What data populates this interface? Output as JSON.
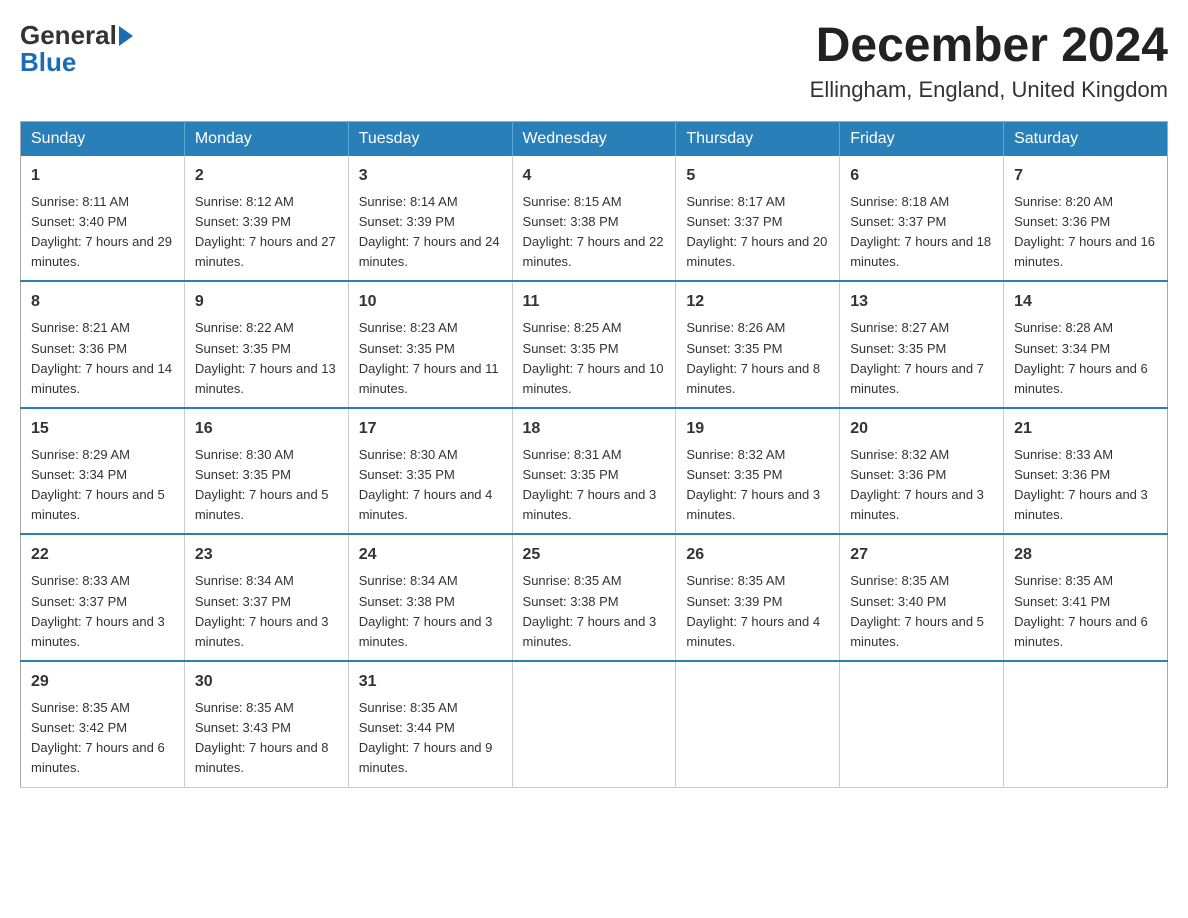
{
  "header": {
    "logo_text1": "General",
    "logo_text2": "Blue",
    "title": "December 2024",
    "subtitle": "Ellingham, England, United Kingdom"
  },
  "days_of_week": [
    "Sunday",
    "Monday",
    "Tuesday",
    "Wednesday",
    "Thursday",
    "Friday",
    "Saturday"
  ],
  "weeks": [
    [
      {
        "num": "1",
        "sunrise": "8:11 AM",
        "sunset": "3:40 PM",
        "daylight": "7 hours and 29 minutes."
      },
      {
        "num": "2",
        "sunrise": "8:12 AM",
        "sunset": "3:39 PM",
        "daylight": "7 hours and 27 minutes."
      },
      {
        "num": "3",
        "sunrise": "8:14 AM",
        "sunset": "3:39 PM",
        "daylight": "7 hours and 24 minutes."
      },
      {
        "num": "4",
        "sunrise": "8:15 AM",
        "sunset": "3:38 PM",
        "daylight": "7 hours and 22 minutes."
      },
      {
        "num": "5",
        "sunrise": "8:17 AM",
        "sunset": "3:37 PM",
        "daylight": "7 hours and 20 minutes."
      },
      {
        "num": "6",
        "sunrise": "8:18 AM",
        "sunset": "3:37 PM",
        "daylight": "7 hours and 18 minutes."
      },
      {
        "num": "7",
        "sunrise": "8:20 AM",
        "sunset": "3:36 PM",
        "daylight": "7 hours and 16 minutes."
      }
    ],
    [
      {
        "num": "8",
        "sunrise": "8:21 AM",
        "sunset": "3:36 PM",
        "daylight": "7 hours and 14 minutes."
      },
      {
        "num": "9",
        "sunrise": "8:22 AM",
        "sunset": "3:35 PM",
        "daylight": "7 hours and 13 minutes."
      },
      {
        "num": "10",
        "sunrise": "8:23 AM",
        "sunset": "3:35 PM",
        "daylight": "7 hours and 11 minutes."
      },
      {
        "num": "11",
        "sunrise": "8:25 AM",
        "sunset": "3:35 PM",
        "daylight": "7 hours and 10 minutes."
      },
      {
        "num": "12",
        "sunrise": "8:26 AM",
        "sunset": "3:35 PM",
        "daylight": "7 hours and 8 minutes."
      },
      {
        "num": "13",
        "sunrise": "8:27 AM",
        "sunset": "3:35 PM",
        "daylight": "7 hours and 7 minutes."
      },
      {
        "num": "14",
        "sunrise": "8:28 AM",
        "sunset": "3:34 PM",
        "daylight": "7 hours and 6 minutes."
      }
    ],
    [
      {
        "num": "15",
        "sunrise": "8:29 AM",
        "sunset": "3:34 PM",
        "daylight": "7 hours and 5 minutes."
      },
      {
        "num": "16",
        "sunrise": "8:30 AM",
        "sunset": "3:35 PM",
        "daylight": "7 hours and 5 minutes."
      },
      {
        "num": "17",
        "sunrise": "8:30 AM",
        "sunset": "3:35 PM",
        "daylight": "7 hours and 4 minutes."
      },
      {
        "num": "18",
        "sunrise": "8:31 AM",
        "sunset": "3:35 PM",
        "daylight": "7 hours and 3 minutes."
      },
      {
        "num": "19",
        "sunrise": "8:32 AM",
        "sunset": "3:35 PM",
        "daylight": "7 hours and 3 minutes."
      },
      {
        "num": "20",
        "sunrise": "8:32 AM",
        "sunset": "3:36 PM",
        "daylight": "7 hours and 3 minutes."
      },
      {
        "num": "21",
        "sunrise": "8:33 AM",
        "sunset": "3:36 PM",
        "daylight": "7 hours and 3 minutes."
      }
    ],
    [
      {
        "num": "22",
        "sunrise": "8:33 AM",
        "sunset": "3:37 PM",
        "daylight": "7 hours and 3 minutes."
      },
      {
        "num": "23",
        "sunrise": "8:34 AM",
        "sunset": "3:37 PM",
        "daylight": "7 hours and 3 minutes."
      },
      {
        "num": "24",
        "sunrise": "8:34 AM",
        "sunset": "3:38 PM",
        "daylight": "7 hours and 3 minutes."
      },
      {
        "num": "25",
        "sunrise": "8:35 AM",
        "sunset": "3:38 PM",
        "daylight": "7 hours and 3 minutes."
      },
      {
        "num": "26",
        "sunrise": "8:35 AM",
        "sunset": "3:39 PM",
        "daylight": "7 hours and 4 minutes."
      },
      {
        "num": "27",
        "sunrise": "8:35 AM",
        "sunset": "3:40 PM",
        "daylight": "7 hours and 5 minutes."
      },
      {
        "num": "28",
        "sunrise": "8:35 AM",
        "sunset": "3:41 PM",
        "daylight": "7 hours and 6 minutes."
      }
    ],
    [
      {
        "num": "29",
        "sunrise": "8:35 AM",
        "sunset": "3:42 PM",
        "daylight": "7 hours and 6 minutes."
      },
      {
        "num": "30",
        "sunrise": "8:35 AM",
        "sunset": "3:43 PM",
        "daylight": "7 hours and 8 minutes."
      },
      {
        "num": "31",
        "sunrise": "8:35 AM",
        "sunset": "3:44 PM",
        "daylight": "7 hours and 9 minutes."
      },
      null,
      null,
      null,
      null
    ]
  ]
}
